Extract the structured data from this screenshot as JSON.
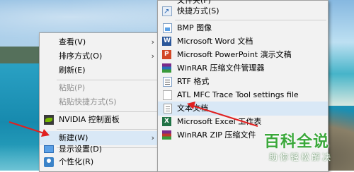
{
  "context_menu": {
    "items": [
      {
        "label": "查看(V)",
        "arrow": "›"
      },
      {
        "label": "排序方式(O)",
        "arrow": "›"
      },
      {
        "label": "刷新(E)"
      },
      {
        "label": "粘贴(P)"
      },
      {
        "label": "粘贴快捷方式(S)"
      },
      {
        "label": "NVIDIA 控制面板",
        "icon": "nvidia-icon"
      },
      {
        "label": "新建(W)",
        "arrow": "›"
      },
      {
        "label": "显示设置(D)",
        "icon": "display-icon"
      },
      {
        "label": "个性化(R)",
        "icon": "personalize-icon"
      }
    ]
  },
  "new_submenu": {
    "items": [
      {
        "label": "文件夹(F)",
        "icon": "folder-icon"
      },
      {
        "label": "快捷方式(S)",
        "icon": "shortcut-icon"
      },
      {
        "label": "BMP 图像",
        "icon": "bmp-icon"
      },
      {
        "label": "Microsoft Word 文档",
        "icon": "word-icon"
      },
      {
        "label": "Microsoft PowerPoint 演示文稿",
        "icon": "powerpoint-icon"
      },
      {
        "label": "WinRAR 压缩文件管理器",
        "icon": "winrar-icon"
      },
      {
        "label": "RTF 格式",
        "icon": "rtf-icon"
      },
      {
        "label": "ATL MFC Trace Tool settings file",
        "icon": "atl-file-icon"
      },
      {
        "label": "文本文档",
        "icon": "text-document-icon"
      },
      {
        "label": "Microsoft Excel 工作表",
        "icon": "excel-icon"
      },
      {
        "label": "WinRAR ZIP 压缩文件",
        "icon": "winrar-zip-icon"
      }
    ]
  },
  "watermark": {
    "title": "百科全说",
    "subtitle": "助你轻松解决"
  },
  "colors": {
    "menu_bg": "#f2f2f2",
    "highlight": "#d9e8f6",
    "annotation_arrow": "#e02020",
    "brand_green": "#3aa83a"
  }
}
